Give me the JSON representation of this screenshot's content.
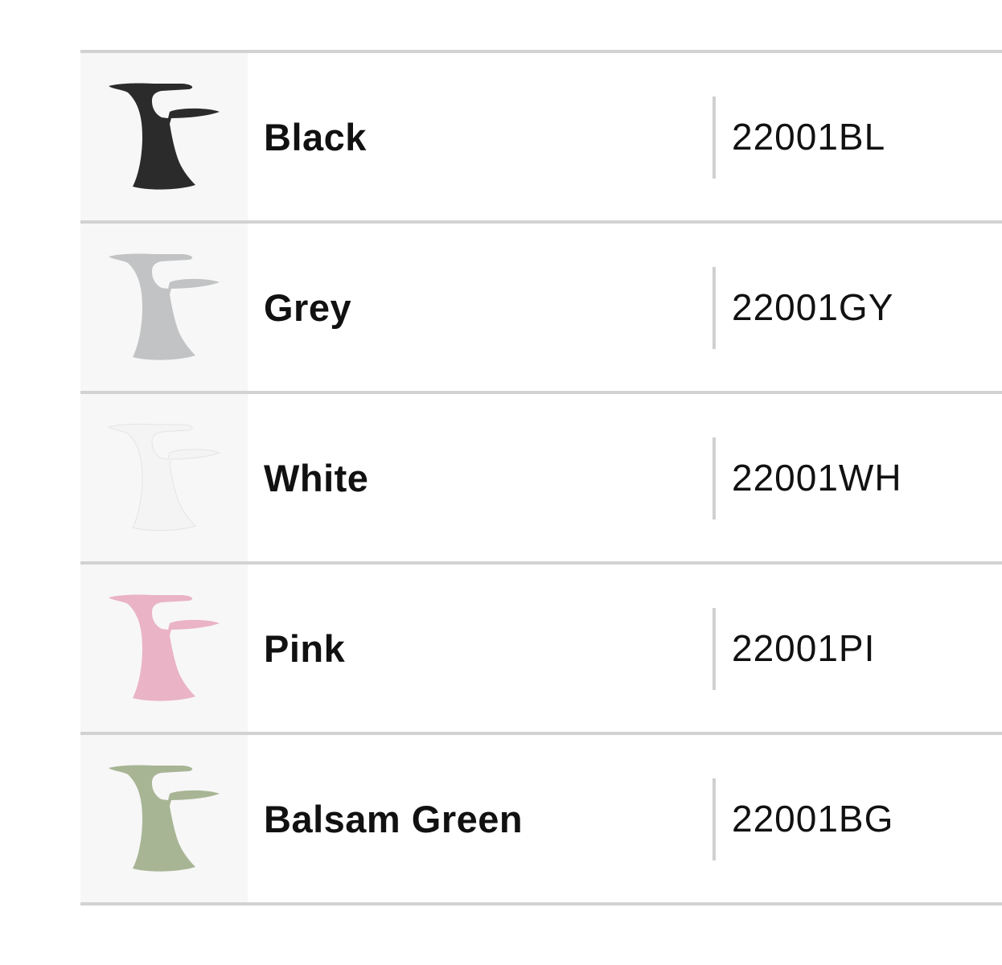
{
  "variants": [
    {
      "name": "Black",
      "code": "22001BL",
      "color": "#2b2b2b",
      "icon": "tree-table-icon"
    },
    {
      "name": "Grey",
      "code": "22001GY",
      "color": "#c2c3c4",
      "icon": "tree-table-icon"
    },
    {
      "name": "White",
      "code": "22001WH",
      "color": "#f4f4f4",
      "icon": "tree-table-icon"
    },
    {
      "name": "Pink",
      "code": "22001PI",
      "color": "#eab3c6",
      "icon": "tree-table-icon"
    },
    {
      "name": "Balsam Green",
      "code": "22001BG",
      "color": "#a8b595",
      "icon": "tree-table-icon"
    }
  ]
}
